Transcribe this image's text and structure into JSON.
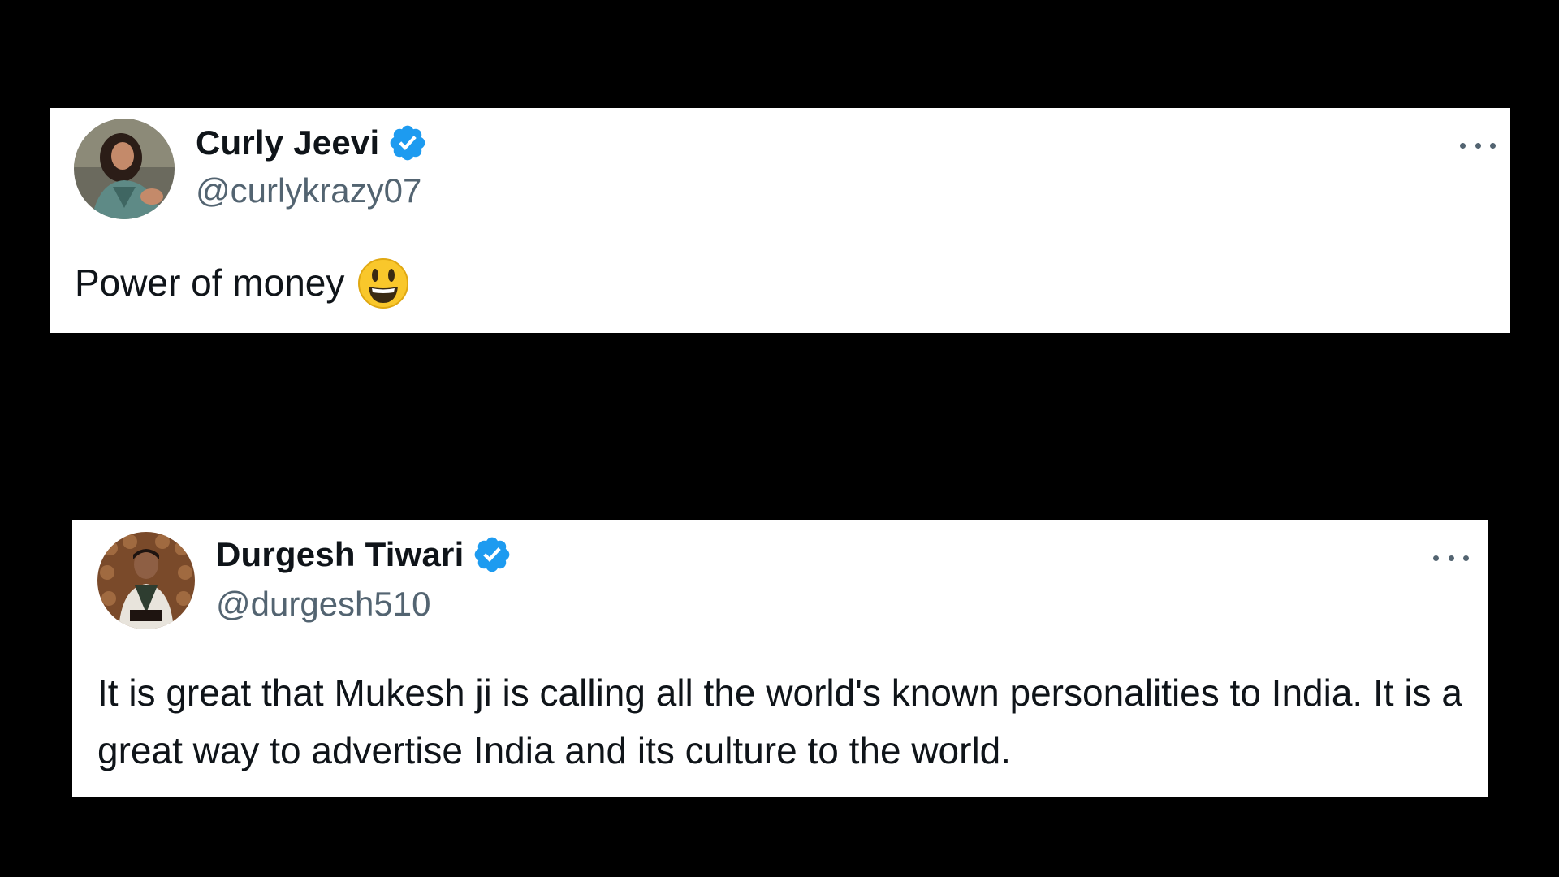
{
  "tweets": [
    {
      "display_name": "Curly Jeevi",
      "handle": "@curlykrazy07",
      "verified": true,
      "text": "Power of money",
      "emoji": "smiling-face-emoji",
      "avatar": "woman-portrait-avatar"
    },
    {
      "display_name": "Durgesh Tiwari",
      "handle": "@durgesh510",
      "verified": true,
      "text": "It is great that Mukesh ji is calling all the world's known personalities to India. It is a great way to advertise India and its culture to the world.",
      "avatar": "man-portrait-avatar"
    }
  ],
  "colors": {
    "background": "#000000",
    "card": "#ffffff",
    "name": "#0f1419",
    "handle": "#536471",
    "verified_badge": "#1d9bf0"
  },
  "icons": {
    "verified": "verified-badge-icon",
    "more": "more-options-icon"
  }
}
